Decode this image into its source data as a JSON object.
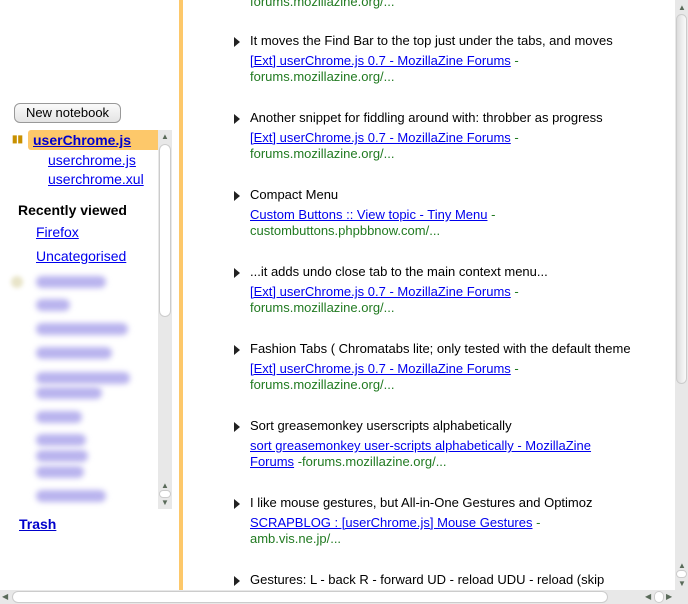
{
  "sidebar": {
    "new_notebook": "New notebook",
    "selected": "userChrome.js",
    "children": [
      "userchrome.js",
      "userchrome.xul"
    ],
    "recently_viewed": "Recently viewed",
    "recent": [
      "Firefox",
      "Uncategorised"
    ],
    "trash": "Trash"
  },
  "main": {
    "top_url": "forums.mozillazine.org/...",
    "entries": [
      {
        "title": "It moves the Find Bar to the top just under the tabs, and moves",
        "link": "[Ext] userChrome.js 0.7 - MozillaZine Forums",
        "url": "forums.mozillazine.org/..."
      },
      {
        "title": "Another snippet for fiddling around with: throbber as progress",
        "link": "[Ext] userChrome.js 0.7 - MozillaZine Forums",
        "url": "forums.mozillazine.org/..."
      },
      {
        "title": "Compact Menu",
        "link": "Custom Buttons :: View topic - Tiny Menu",
        "url": "custombuttons.phpbbnow.com/..."
      },
      {
        "title": "...it adds undo close tab to the main context menu...",
        "link": "[Ext] userChrome.js 0.7 - MozillaZine Forums",
        "url": "forums.mozillazine.org/..."
      },
      {
        "title": "Fashion Tabs ( Chromatabs lite; only tested with the default theme",
        "link": "[Ext] userChrome.js 0.7 - MozillaZine Forums",
        "url": "forums.mozillazine.org/..."
      },
      {
        "title": "Sort greasemonkey userscripts alphabetically",
        "link": "sort greasemonkey user-scripts alphabetically - MozillaZine Forums",
        "url": "forums.mozillazine.org/..."
      },
      {
        "title": "I like mouse gestures, but All-in-One Gestures and Optimoz",
        "link": "SCRAPBLOG : [userChrome.js] Mouse Gestures",
        "url": "amb.vis.ne.jp/..."
      },
      {
        "title": "Gestures: L - back R - forward UD - reload UDU - reload (skip",
        "link": "",
        "url": ""
      }
    ]
  }
}
